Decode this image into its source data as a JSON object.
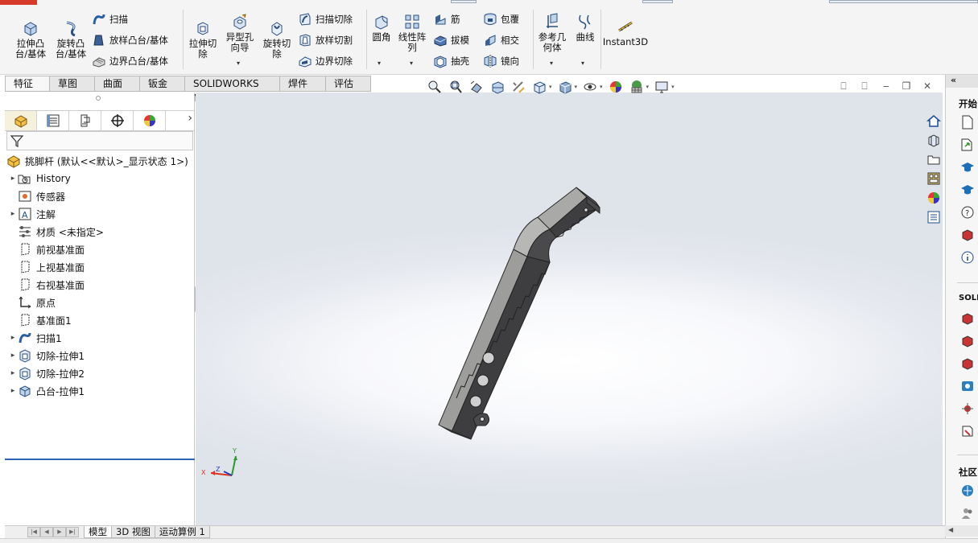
{
  "ribbon": {
    "extrude_boss": "拉伸凸\n台/基体",
    "revolve_boss": "旋转凸\n台/基体",
    "sweep": "扫描",
    "loft_boss": "放样凸台/基体",
    "boundary_boss": "边界凸台/基体",
    "extrude_cut": "拉伸切\n除",
    "hole_wizard": "异型孔\n向导",
    "revolve_cut": "旋转切\n除",
    "swept_cut": "扫描切除",
    "lofted_cut": "放样切割",
    "boundary_cut": "边界切除",
    "fillet": "圆角",
    "linear_pattern": "线性阵\n列",
    "rib": "筋",
    "draft": "拔模",
    "shell": "抽壳",
    "wrap": "包覆",
    "intersect": "相交",
    "mirror": "镜向",
    "reference_geometry": "参考几\n何体",
    "curves": "曲线",
    "instant3d": "Instant3D"
  },
  "tabs": [
    "特征",
    "草图",
    "曲面",
    "钣金",
    "SOLIDWORKS MBD",
    "焊件(D)",
    "评估"
  ],
  "active_tab": "特征",
  "tree": {
    "root": "挑脚杆 (默认<<默认>_显示状态 1>)",
    "items": [
      {
        "label": "History",
        "icon": "history-folder-icon",
        "expand": true
      },
      {
        "label": "传感器",
        "icon": "sensor-icon",
        "expand": false
      },
      {
        "label": "注解",
        "icon": "annotation-icon",
        "expand": true
      },
      {
        "label": "材质 <未指定>",
        "icon": "material-icon",
        "expand": false
      },
      {
        "label": "前视基准面",
        "icon": "plane-icon",
        "expand": false
      },
      {
        "label": "上视基准面",
        "icon": "plane-icon",
        "expand": false
      },
      {
        "label": "右视基准面",
        "icon": "plane-icon",
        "expand": false
      },
      {
        "label": "原点",
        "icon": "origin-icon",
        "expand": false
      },
      {
        "label": "基准面1",
        "icon": "plane-icon",
        "expand": false
      },
      {
        "label": "扫描1",
        "icon": "sweep-feature-icon",
        "expand": true
      },
      {
        "label": "切除-拉伸1",
        "icon": "cut-extrude-icon",
        "expand": true
      },
      {
        "label": "切除-拉伸2",
        "icon": "cut-extrude-icon",
        "expand": true
      },
      {
        "label": "凸台-拉伸1",
        "icon": "boss-extrude-icon",
        "expand": true
      }
    ]
  },
  "bottom_tabs": [
    "模型",
    "3D 视图",
    "运动算例 1"
  ],
  "active_bottom_tab": "模型",
  "triad": {
    "x": "X",
    "y": "Y",
    "z": "Z"
  },
  "taskpane": {
    "header": "«",
    "section_start": "开始",
    "section_solidworks": "SOLI",
    "section_community": "社区"
  },
  "colors": {
    "accent_blue": "#2f63b6",
    "brand_red": "#d63a2a",
    "part_gray": "#a9a9a7",
    "part_dark": "#3b3a3d"
  }
}
